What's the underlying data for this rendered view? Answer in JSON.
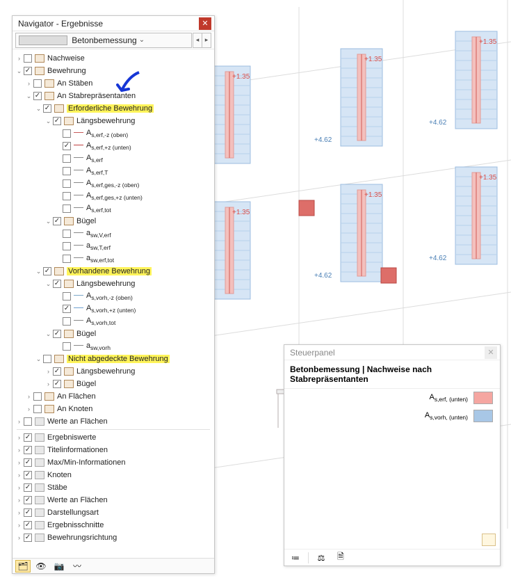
{
  "navigator": {
    "title": "Navigator - Ergebnisse",
    "combo_label": "Betonbemessung",
    "tree": [
      {
        "depth": 0,
        "tw": ">",
        "cb": false,
        "icon": "t",
        "label": "Nachweise"
      },
      {
        "depth": 0,
        "tw": "v",
        "cb": true,
        "icon": "t",
        "label": "Bewehrung"
      },
      {
        "depth": 1,
        "tw": ">",
        "cb": false,
        "icon": "t",
        "label": "An Stäben"
      },
      {
        "depth": 1,
        "tw": "v",
        "cb": true,
        "icon": "t",
        "label": "An Stabrepräsentanten"
      },
      {
        "depth": 2,
        "tw": "v",
        "cb": true,
        "icon": "t",
        "label": "Erforderliche Bewehrung",
        "hl": true
      },
      {
        "depth": 3,
        "tw": "v",
        "cb": true,
        "icon": "t",
        "label": "Längsbewehrung"
      },
      {
        "depth": 4,
        "cb": false,
        "line": "#c85a5a",
        "label_html": "A<sub>s,erf,-z (oben)</sub>"
      },
      {
        "depth": 4,
        "cb": true,
        "line": "#c04040",
        "label_html": "A<sub>s,erf,+z (unten)</sub>"
      },
      {
        "depth": 4,
        "cb": false,
        "line": "#888",
        "label_html": "A<sub>s,erf</sub>"
      },
      {
        "depth": 4,
        "cb": false,
        "line": "#888",
        "label_html": "A<sub>s,erf,T</sub>"
      },
      {
        "depth": 4,
        "cb": false,
        "line": "#888",
        "label_html": "A<sub>s,erf,ges,-z (oben)</sub>"
      },
      {
        "depth": 4,
        "cb": false,
        "line": "#888",
        "label_html": "A<sub>s,erf,ges,+z (unten)</sub>"
      },
      {
        "depth": 4,
        "cb": false,
        "line": "#888",
        "label_html": "A<sub>s,erf,tot</sub>"
      },
      {
        "depth": 3,
        "tw": "v",
        "cb": true,
        "icon": "t",
        "label": "Bügel"
      },
      {
        "depth": 4,
        "cb": false,
        "line": "#888",
        "label_html": "a<sub>sw,V,erf</sub>"
      },
      {
        "depth": 4,
        "cb": false,
        "line": "#888",
        "label_html": "a<sub>sw,T,erf</sub>"
      },
      {
        "depth": 4,
        "cb": false,
        "line": "#888",
        "label_html": "a<sub>sw,erf,tot</sub>"
      },
      {
        "depth": 2,
        "tw": "v",
        "cb": true,
        "icon": "t",
        "label": "Vorhandene Bewehrung",
        "hl": true
      },
      {
        "depth": 3,
        "tw": "v",
        "cb": true,
        "icon": "t",
        "label": "Längsbewehrung"
      },
      {
        "depth": 4,
        "cb": false,
        "line": "#7ba7c9",
        "label_html": "A<sub>s,vorh,-z (oben)</sub>"
      },
      {
        "depth": 4,
        "cb": true,
        "line": "#6fa0cf",
        "label_html": "A<sub>s,vorh,+z (unten)</sub>"
      },
      {
        "depth": 4,
        "cb": false,
        "line": "#888",
        "label_html": "A<sub>s,vorh,tot</sub>"
      },
      {
        "depth": 3,
        "tw": "v",
        "cb": true,
        "icon": "t",
        "label": "Bügel"
      },
      {
        "depth": 4,
        "cb": false,
        "line": "#888",
        "label_html": "a<sub>sw,vorh</sub>"
      },
      {
        "depth": 2,
        "tw": "v",
        "cb": false,
        "icon": "t",
        "label": "Nicht abgedeckte Bewehrung",
        "hl": true
      },
      {
        "depth": 3,
        "tw": ">",
        "cb": true,
        "icon": "t",
        "label": "Längsbewehrung"
      },
      {
        "depth": 3,
        "tw": ">",
        "cb": true,
        "icon": "t",
        "label": "Bügel"
      },
      {
        "depth": 1,
        "tw": ">",
        "cb": false,
        "icon": "t",
        "label": "An Flächen"
      },
      {
        "depth": 1,
        "tw": ">",
        "cb": false,
        "icon": "t",
        "label": "An Knoten"
      },
      {
        "depth": 0,
        "tw": ">",
        "cb": false,
        "icon": "g",
        "label": "Werte an Flächen"
      },
      {
        "sep": true
      },
      {
        "depth": 0,
        "tw": ">",
        "cb": true,
        "icon": "g",
        "label": "Ergebniswerte"
      },
      {
        "depth": 0,
        "tw": ">",
        "cb": true,
        "icon": "g",
        "label": "Titelinformationen"
      },
      {
        "depth": 0,
        "tw": ">",
        "cb": true,
        "icon": "g",
        "label": "Max/Min-Informationen"
      },
      {
        "depth": 0,
        "tw": ">",
        "cb": true,
        "icon": "g",
        "label": "Knoten"
      },
      {
        "depth": 0,
        "tw": ">",
        "cb": true,
        "icon": "g",
        "label": "Stäbe"
      },
      {
        "depth": 0,
        "tw": ">",
        "cb": true,
        "icon": "g",
        "label": "Werte an Flächen"
      },
      {
        "depth": 0,
        "tw": ">",
        "cb": true,
        "icon": "g",
        "label": "Darstellungsart"
      },
      {
        "depth": 0,
        "tw": ">",
        "cb": true,
        "icon": "g",
        "label": "Ergebnisschnitte"
      },
      {
        "depth": 0,
        "tw": ">",
        "cb": true,
        "icon": "g",
        "label": "Bewehrungsrichtung"
      }
    ],
    "footer_icons": [
      "🗂",
      "👁",
      "📷",
      "〰"
    ]
  },
  "ctrlpanel": {
    "title": "Steuerpanel",
    "heading": "Betonbemessung | Nachweise nach Stabrepräsentanten",
    "legend": [
      {
        "label_html": "A<sub>s,erf, (unten)</sub>",
        "color": "#f5a6a1"
      },
      {
        "label_html": "A<sub>s,vorh, (unten)</sub>",
        "color": "#a8c7e6"
      }
    ],
    "footer_icons": [
      "≔",
      "⚖",
      "🗎"
    ]
  },
  "viewport": {
    "red_labels": [
      "+1.35",
      "+1.35",
      "+1.35",
      "+1.35",
      "+1.35",
      "+1.35"
    ],
    "blue_labels": [
      "+4.62",
      "+4.62",
      "+4.62",
      "+4.62",
      "+4.62",
      "+4.62"
    ]
  },
  "colors": {
    "red": "#d94f4a",
    "blue": "#4a7fb5",
    "hl": "#fff45a"
  }
}
